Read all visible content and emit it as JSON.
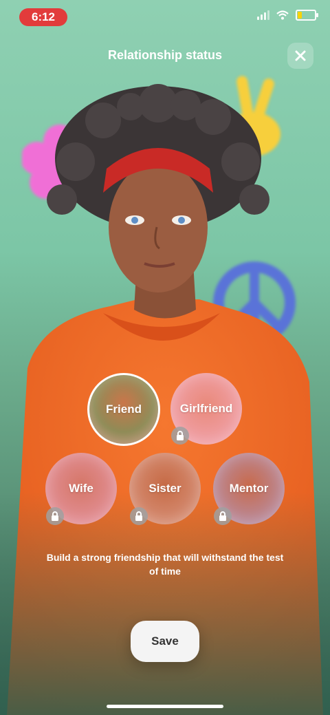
{
  "status_bar": {
    "time": "6:12"
  },
  "header": {
    "title": "Relationship status"
  },
  "options": [
    {
      "label": "Friend",
      "selected": true,
      "locked": false
    },
    {
      "label": "Girlfriend",
      "selected": false,
      "locked": true
    },
    {
      "label": "Wife",
      "selected": false,
      "locked": true
    },
    {
      "label": "Sister",
      "selected": false,
      "locked": true
    },
    {
      "label": "Mentor",
      "selected": false,
      "locked": true
    }
  ],
  "description": "Build a strong friendship that will withstand the test of time",
  "save_label": "Save",
  "icons": {
    "close": "close-icon",
    "lock": "lock-icon",
    "wifi": "wifi-icon",
    "battery": "battery-icon",
    "signal": "signal-icon"
  },
  "colors": {
    "accent_red": "#e23b3b",
    "background_green": "#7cc6a6",
    "sweater_orange": "#f06a2c"
  }
}
